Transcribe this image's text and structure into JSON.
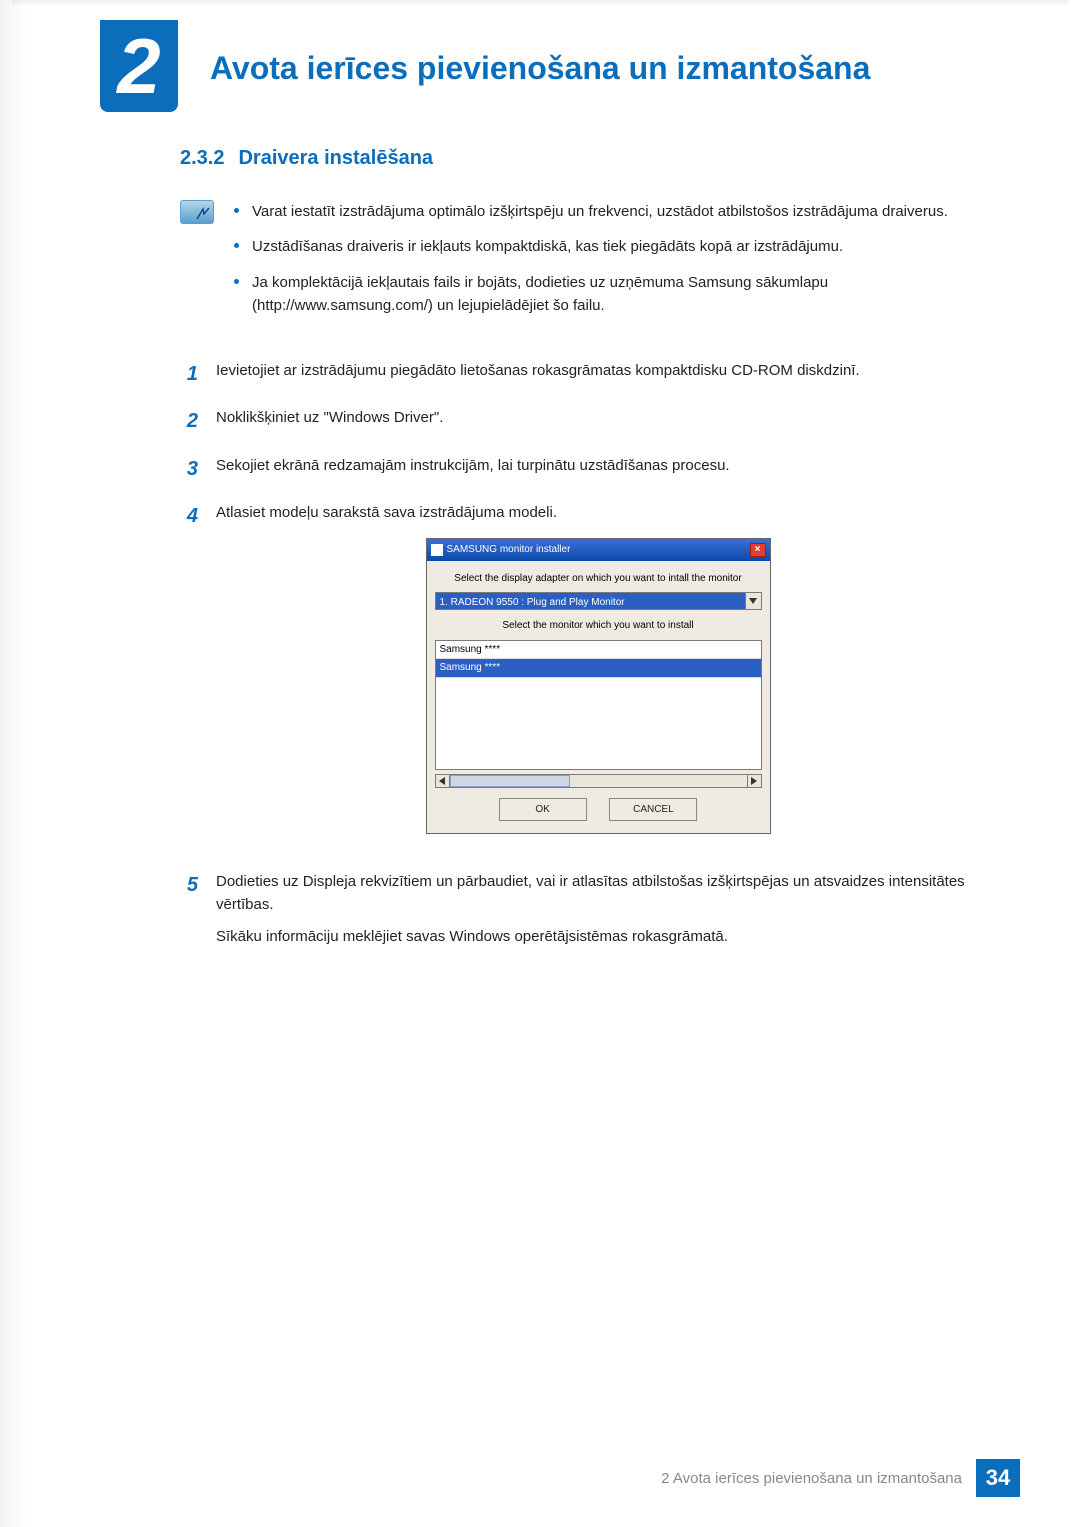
{
  "chapter": {
    "number": "2",
    "title": "Avota ierīces pievienošana un izmantošana"
  },
  "section": {
    "number": "2.3.2",
    "title": "Draivera instalēšana"
  },
  "notes": [
    "Varat iestatīt izstrādājuma optimālo izšķirtspēju un frekvenci, uzstādot atbilstošos izstrādājuma draiverus.",
    "Uzstādīšanas draiveris ir iekļauts kompaktdiskā, kas tiek piegādāts kopā ar izstrādājumu.",
    "Ja komplektācijā iekļautais fails ir bojāts, dodieties uz uzņēmuma Samsung sākumlapu (http://www.samsung.com/) un lejupielādējiet šo failu."
  ],
  "steps": [
    {
      "num": "1",
      "text": "Ievietojiet ar izstrādājumu piegādāto lietošanas rokasgrāmatas kompaktdisku CD-ROM diskdzinī."
    },
    {
      "num": "2",
      "text": "Noklikšķiniet uz \"Windows Driver\"."
    },
    {
      "num": "3",
      "text": "Sekojiet ekrānā redzamajām instrukcijām, lai turpinātu uzstādīšanas procesu."
    },
    {
      "num": "4",
      "text": "Atlasiet modeļu sarakstā sava izstrādājuma modeli."
    },
    {
      "num": "5",
      "text": "Dodieties uz Displeja rekvizītiem un pārbaudiet, vai ir atlasītas atbilstošas izšķirtspējas un atsvaidzes intensitātes vērtības.",
      "extra": "Sīkāku informāciju meklējiet savas Windows operētājsistēmas rokasgrāmatā."
    }
  ],
  "screenshot": {
    "title": "SAMSUNG monitor installer",
    "label1": "Select the display adapter on which you want to intall the monitor",
    "select_value": "1. RADEON 9550 : Plug and Play Monitor",
    "label2": "Select the monitor which you want to install",
    "list_items": [
      "Samsung ****",
      "Samsung ****"
    ],
    "btn_ok": "OK",
    "btn_cancel": "CANCEL"
  },
  "footer": {
    "text": "2 Avota ierīces pievienošana un izmantošana",
    "page": "34"
  }
}
